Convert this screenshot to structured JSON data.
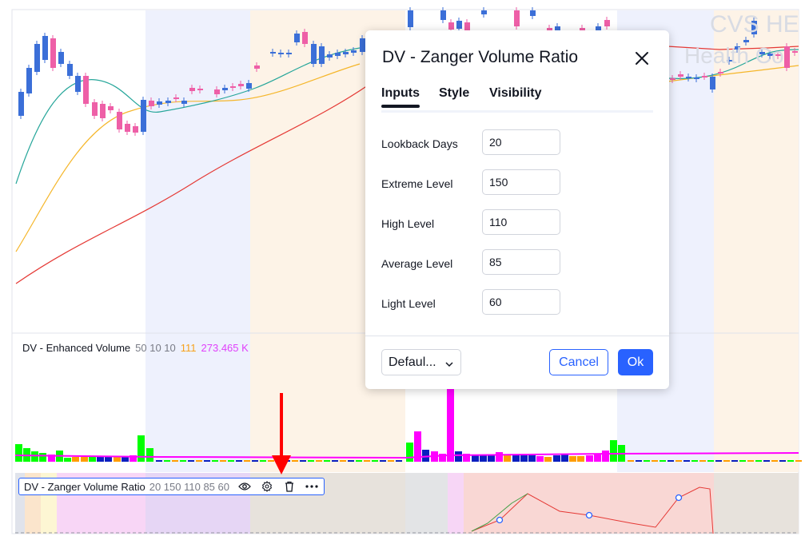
{
  "watermark": {
    "line1": "CVS HE",
    "line2": "Health Co"
  },
  "volume_legend": {
    "name": "DV - Enhanced Volume",
    "params": "50 10 10",
    "value1": "111",
    "value2": "273.465 K",
    "value1_color": "#f7a21b",
    "value2_color": "#e040fb"
  },
  "indicator_bar": {
    "name": "DV - Zanger Volume Ratio",
    "params": "20 150 110 85 60",
    "icons": [
      "eye-icon",
      "gear-icon",
      "trash-icon",
      "more-icon"
    ]
  },
  "dialog": {
    "title": "DV - Zanger Volume Ratio",
    "tabs": [
      "Inputs",
      "Style",
      "Visibility"
    ],
    "active_tab": "Inputs",
    "inputs": [
      {
        "label": "Lookback Days",
        "value": "20"
      },
      {
        "label": "Extreme Level",
        "value": "150"
      },
      {
        "label": "High Level",
        "value": "110"
      },
      {
        "label": "Average Level",
        "value": "85"
      },
      {
        "label": "Light Level",
        "value": "60"
      }
    ],
    "defaults_label": "Defaul...",
    "cancel_label": "Cancel",
    "ok_label": "Ok"
  },
  "colors": {
    "up": "#3b6fd8",
    "down": "#ee5fa7",
    "ma_fast": "#26a69a",
    "ma_mid": "#f5b62a",
    "ma_slow": "#e53935",
    "vol_line": "#ff00ff",
    "accent": "#2962ff",
    "annotation_arrow": "#ff0000"
  },
  "chart_data": {
    "type": "candlestick",
    "panes": [
      "price",
      "volume",
      "zanger-volume-ratio"
    ],
    "moving_averages": [
      "fast",
      "mid",
      "slow"
    ],
    "annotation": "red arrow pointing at indicator settings gear icon"
  }
}
